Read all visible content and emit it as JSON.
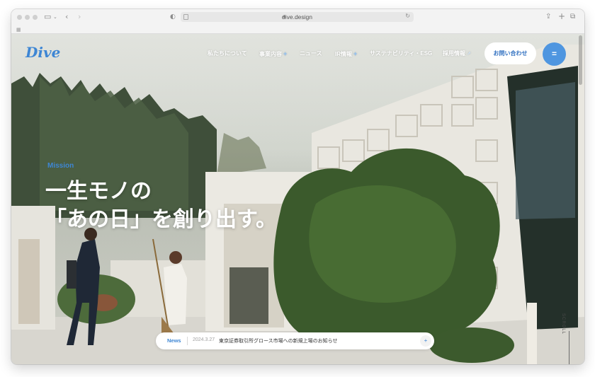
{
  "browser": {
    "url": "dive.design",
    "icons": [
      "sidebar-icon",
      "chevron-down-icon",
      "back-icon",
      "forward-icon",
      "shield-icon",
      "page-icon",
      "lock-icon",
      "reload-icon",
      "share-icon",
      "new-tab-icon",
      "tabs-overview-icon",
      "tab-grid-icon"
    ]
  },
  "site": {
    "logo": "Dive",
    "nav": [
      {
        "label": "私たちについて",
        "suffix": ""
      },
      {
        "label": "事業内容",
        "suffix": "+"
      },
      {
        "label": "ニュース",
        "suffix": ""
      },
      {
        "label": "IR情報",
        "suffix": "+"
      },
      {
        "label": "サステナビリティ・ESG",
        "suffix": ""
      },
      {
        "label": "採用情報",
        "suffix": "↗"
      }
    ],
    "contact_label": "お問い合わせ",
    "menu_icon": "hamburger-icon",
    "accent": "#3e86d4"
  },
  "hero": {
    "label": "Mission",
    "headline_line1": "一生モノの",
    "headline_line2": "「あの日」を創り出す。"
  },
  "news": {
    "label": "News",
    "date": "2024.3.27",
    "title": "東京証券取引所グロース市場への新規上場のお知らせ",
    "arrow": "+"
  },
  "scroll": {
    "label": "SCROLL"
  }
}
